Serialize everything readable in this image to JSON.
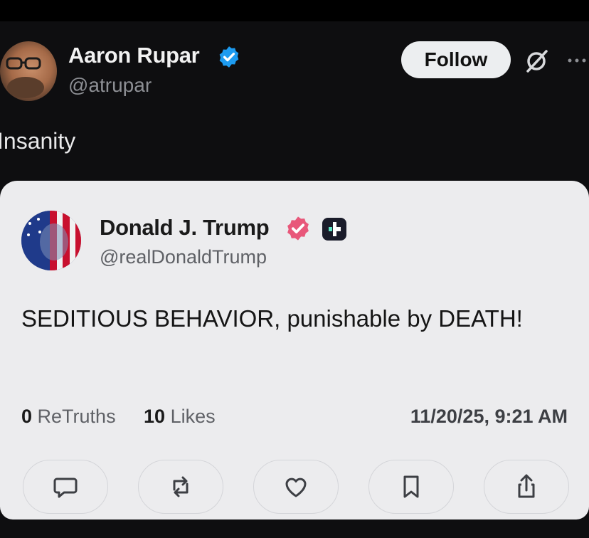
{
  "post": {
    "author_name": "Aaron Rupar",
    "author_handle": "@atrupar",
    "follow_label": "Follow",
    "text": "Insanity"
  },
  "quoted": {
    "author_name": "Donald J. Trump",
    "author_handle": "@realDonaldTrump",
    "text": "SEDITIOUS BEHAVIOR, punishable by DEATH!",
    "retruths_count": "0",
    "retruths_label": "ReTruths",
    "likes_count": "10",
    "likes_label": "Likes",
    "timestamp": "11/20/25, 9:21 AM",
    "actions": [
      "comment-icon",
      "retruth-icon",
      "heart-icon",
      "bookmark-icon",
      "share-icon"
    ]
  },
  "colors": {
    "verified_blue": "#1d9bf0",
    "truth_badge": "#e8577a",
    "card_bg": "#ececee",
    "page_bg": "#0e0e10"
  }
}
